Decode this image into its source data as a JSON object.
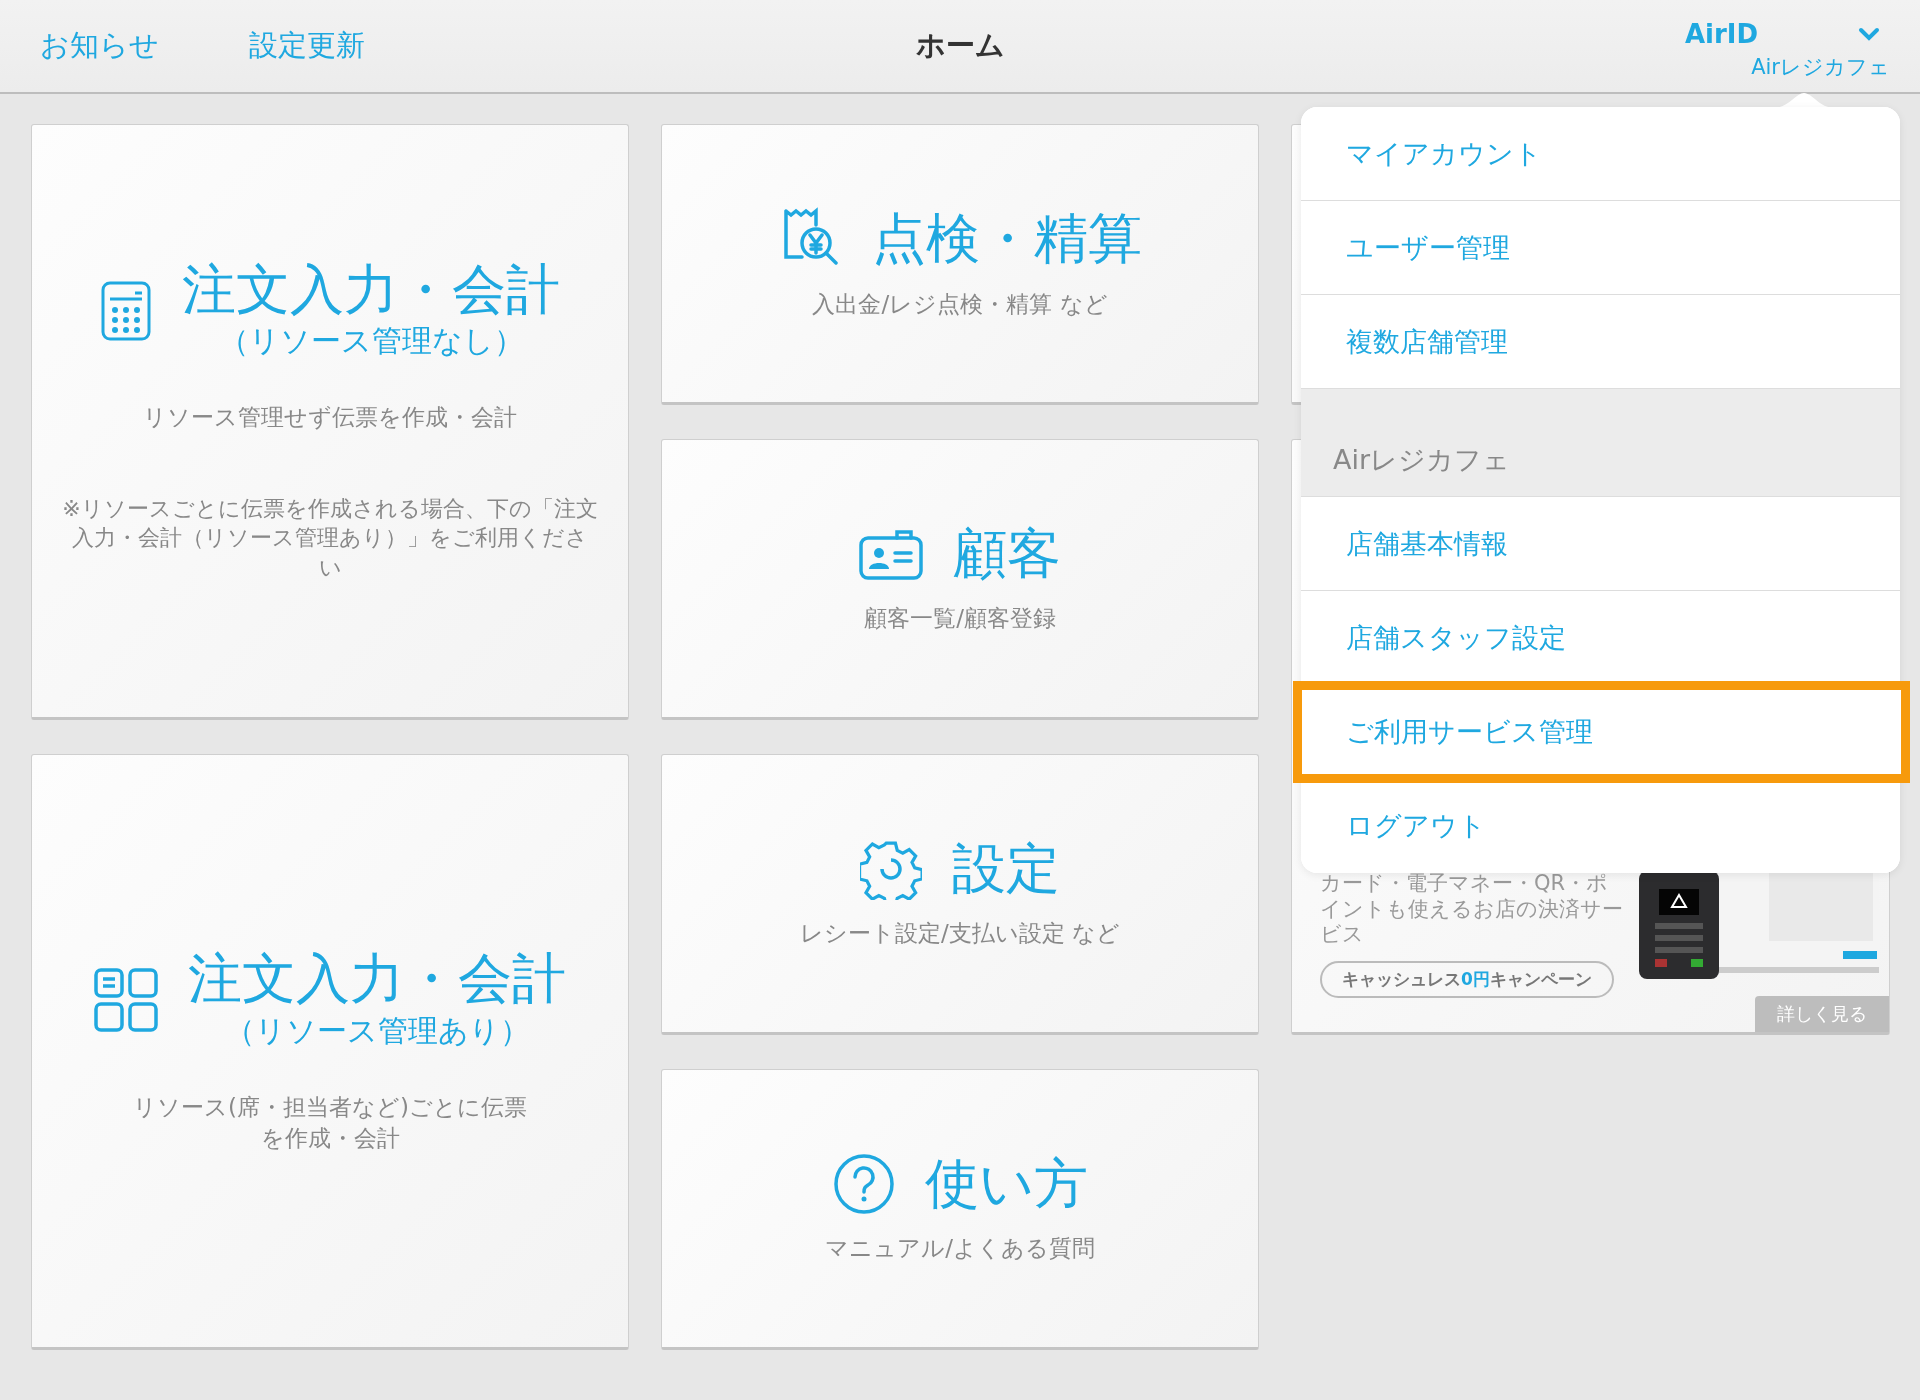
{
  "top_bar": {
    "links": [
      "お知らせ",
      "設定更新"
    ],
    "title": "ホーム",
    "account": {
      "name": "AirID",
      "store": "Airレジカフェ"
    }
  },
  "columns": [
    [
      {
        "kind": "menu",
        "title": "注文入力・会計",
        "subtitle": "（リソース管理なし）",
        "description": "リソース管理せず伝票を作成・会計",
        "note": "※リソースごとに伝票を作成される場合、下の「注文入力・会計（リソース管理あり）」をご利用ください"
      },
      {
        "kind": "menu",
        "title": "注文入力・会計",
        "subtitle": "（リソース管理あり）",
        "description": "リソース(席・担当者など)ごとに伝票を作成・会計"
      }
    ],
    [
      {
        "kind": "menu",
        "title": "点検・精算",
        "description": "入出金/レジ点検・精算 など"
      },
      {
        "kind": "menu",
        "title": "顧客",
        "description": "顧客一覧/顧客登録"
      },
      {
        "kind": "menu",
        "title": "設定",
        "description": "レシート設定/支払い設定 など"
      },
      {
        "kind": "menu",
        "title": "使い方",
        "description": "マニュアル/よくある質問"
      }
    ],
    [
      {
        "kind": "blank"
      },
      {
        "kind": "ad",
        "text": "カード・電子マネー・QR・ポイントも使えるお店の決済サービス",
        "campaign": "キャッシュレス**0円**キャンペーン",
        "more": "詳しく見る"
      }
    ]
  ],
  "account_menu": {
    "sections": [
      {
        "items": [
          {
            "label": "マイアカウント",
            "highlighted": false
          },
          {
            "label": "ユーザー管理",
            "highlighted": false
          },
          {
            "label": "複数店舗管理",
            "highlighted": false
          }
        ]
      },
      {
        "title": "Airレジカフェ",
        "items": [
          {
            "label": "店舗基本情報",
            "highlighted": false
          },
          {
            "label": "店舗スタッフ設定",
            "highlighted": false
          },
          {
            "label": "ご利用サービス管理",
            "highlighted": true
          },
          {
            "label": "ログアウト",
            "highlighted": false
          }
        ]
      }
    ]
  }
}
